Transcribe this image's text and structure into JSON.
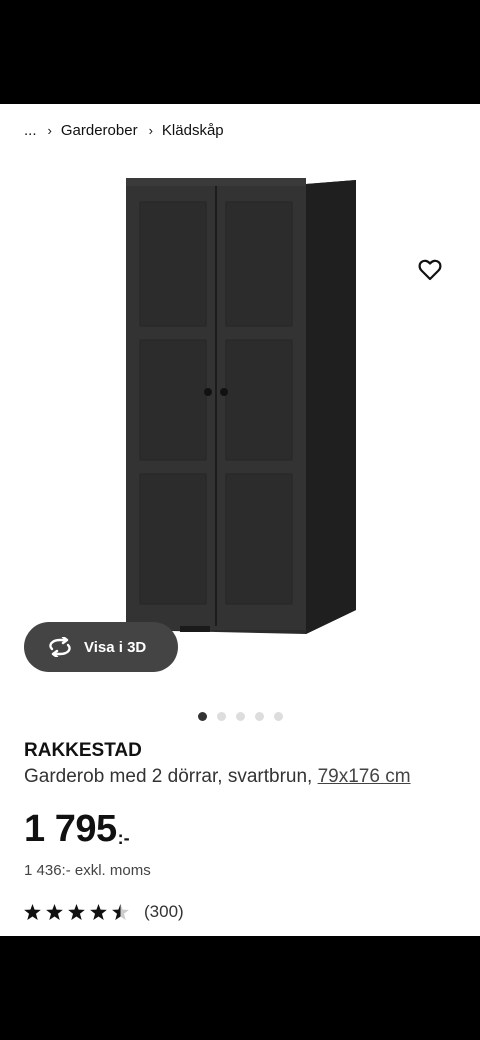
{
  "breadcrumb": {
    "ellipsis": "...",
    "items": [
      "Garderober",
      "Klädskåp"
    ]
  },
  "gallery": {
    "view3d_label": "Visa i 3D",
    "image_count": 5,
    "active_index": 0
  },
  "product": {
    "name": "RAKKESTAD",
    "description": "Garderob med 2 dörrar, svartbrun,",
    "dimensions": "79x176 cm",
    "price_main": "1 795",
    "price_suffix": ":-",
    "price_excl": "1 436:- exkl. moms",
    "rating_value": 4.5,
    "rating_count": "(300)"
  },
  "colors": {
    "accent_yellow": "#fbd914",
    "wardrobe": "#2f2f2f"
  },
  "icons": {
    "favorite": "heart-icon",
    "view3d": "rotate-icon",
    "chat": "chat-icon",
    "star": "star-icon"
  }
}
